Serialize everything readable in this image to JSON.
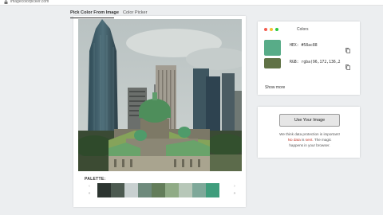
{
  "browser": {
    "url": "imagecolorpicker.com"
  },
  "nav": {
    "tabs": [
      {
        "label": "Pick Color From Image",
        "active": true
      },
      {
        "label": "Color Picker",
        "active": false
      }
    ]
  },
  "image": {
    "description": ""
  },
  "palette": {
    "label": "PALETTE:",
    "colors": [
      "#2c3530",
      "#4c5a50",
      "#c8d0d0",
      "#6e8a7c",
      "#637d5a",
      "#90ab86",
      "#b7c7b8",
      "#7ea899",
      "#3f9d7c"
    ]
  },
  "colors_panel": {
    "title": "Colors",
    "hex_row": {
      "swatch": "#58ac88",
      "text": "HEX: #58ac88"
    },
    "rgb_row": {
      "swatch": "#607246",
      "text": "RGB: rgba(96,172,136,2"
    },
    "show_more": "Show more"
  },
  "upload_panel": {
    "button_label": "Use Your Image",
    "note_line1": "We think data protection is important!",
    "note_line2_a": "No data",
    "note_line2_b": "is",
    "note_line2_c": "sent.",
    "note_line2_d": "The magic",
    "note_line3": "happens in your browser."
  },
  "colors": {
    "page_bg": "#eceef0",
    "accent_green": "#58ac88",
    "dark_text": "#333333",
    "highlight_red": "#c0392b"
  }
}
